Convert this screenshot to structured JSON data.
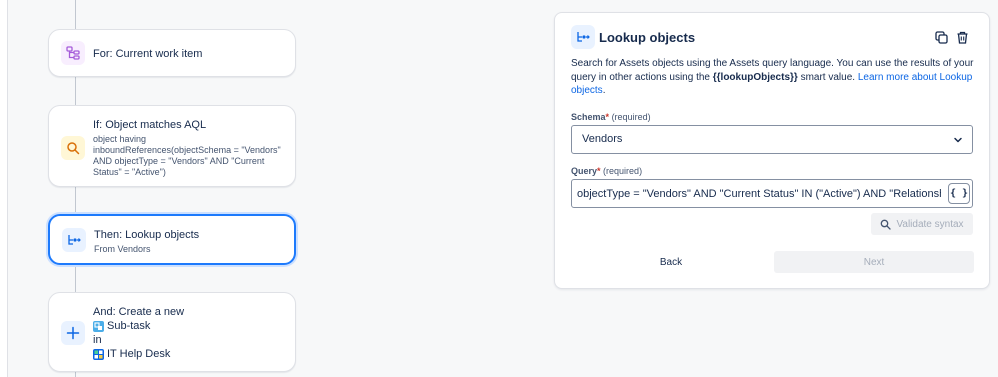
{
  "flow": {
    "nodes": [
      {
        "title": "For: Current work item",
        "icon": "branch-icon",
        "icon_color": "#a55bd9"
      },
      {
        "title": "If: Object matches AQL",
        "sub": "object having inboundReferences(objectSchema = \"Vendors\" AND objectType = \"Vendors\" AND \"Current Status\" = \"Active\")",
        "icon": "search-icon",
        "icon_color": "#d97008"
      },
      {
        "title": "Then: Lookup objects",
        "sub": "From Vendors",
        "icon": "lookup-icon",
        "icon_color": "#0c66e4"
      },
      {
        "title": "And: Create a new",
        "line1": "Sub-task",
        "line2": "in",
        "line3": "IT Help Desk",
        "icon": "plus-icon",
        "icon_color": "#0c66e4"
      }
    ]
  },
  "panel": {
    "title": "Lookup objects",
    "description": {
      "part1": "Search for Assets objects using the Assets query language. You can use the results of your query in other actions using the ",
      "smart_value": "{{lookupObjects}}",
      "part2": " smart value. ",
      "link": "Learn more about Lookup objects",
      "part3": "."
    },
    "schema": {
      "label": "Schema",
      "required_mark": "*",
      "required_text": "(required)",
      "value": "Vendors"
    },
    "query": {
      "label": "Query",
      "required_mark": "*",
      "required_text": "(required)",
      "value": "objectType = \"Vendors\" AND \"Current Status\" IN (\"Active\") AND \"Relationship M",
      "braces": "{ }"
    },
    "validate_label": "Validate syntax",
    "back_label": "Back",
    "next_label": "Next"
  },
  "colors": {
    "accent": "#1d7afc",
    "link": "#0c66e4",
    "required": "#c9372c"
  }
}
